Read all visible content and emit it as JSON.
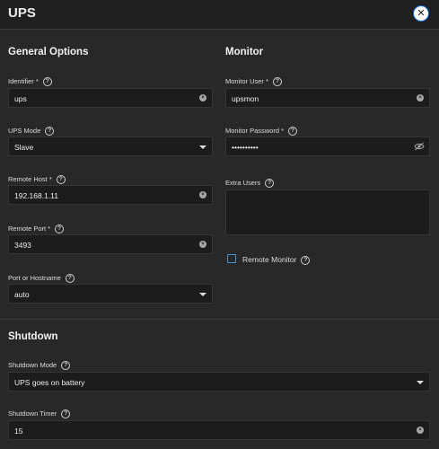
{
  "dialog": {
    "title": "UPS",
    "close_icon": "close-circle-icon"
  },
  "general": {
    "title": "General Options",
    "identifier": {
      "label": "Identifier *",
      "value": "ups"
    },
    "ups_mode": {
      "label": "UPS Mode",
      "value": "Slave"
    },
    "remote_host": {
      "label": "Remote Host *",
      "value": "192.168.1.11"
    },
    "remote_port": {
      "label": "Remote Port *",
      "value": "3493"
    },
    "port_or_hostname": {
      "label": "Port or Hostname",
      "value": "auto"
    }
  },
  "monitor": {
    "title": "Monitor",
    "user": {
      "label": "Monitor User *",
      "value": "upsmon"
    },
    "password": {
      "label": "Monitor Password *",
      "value": "••••••••••"
    },
    "extra_users": {
      "label": "Extra Users",
      "value": ""
    },
    "remote_monitor": {
      "label": "Remote Monitor",
      "checked": false
    }
  },
  "shutdown": {
    "title": "Shutdown",
    "mode": {
      "label": "Shutdown Mode",
      "value": "UPS goes on battery"
    },
    "timer": {
      "label": "Shutdown Timer",
      "value": "15"
    }
  },
  "help_glyph": "?",
  "clear_glyph": "×",
  "colors": {
    "checkbox_border": "#4a90c8",
    "close_ring": "#0a66d8"
  }
}
